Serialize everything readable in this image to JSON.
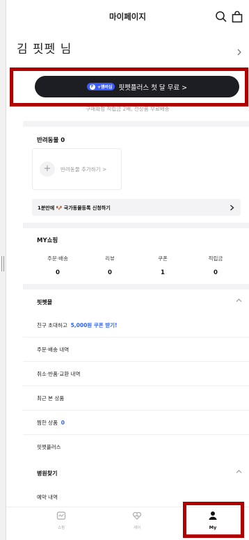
{
  "header": {
    "title": "마이페이지",
    "search_icon": "search-icon",
    "cart_icon": "shopping-bag-icon"
  },
  "user": {
    "name": "김 핏펫 님"
  },
  "membership": {
    "badge_letter": "F",
    "badge_text": "+멤버십",
    "cta_label": "핏펫플러스 첫 달 무료 >",
    "note": "구매확정 적립금 2배, 전상품 무료배송"
  },
  "pets": {
    "title": "반려동물 0",
    "add_label": "반려동물 추가하기 >",
    "register_label": "1분만에 🐶 국가동물등록 신청하기"
  },
  "my_shopping": {
    "title": "MY쇼핑",
    "stats": [
      {
        "label": "주문·배송",
        "value": "0"
      },
      {
        "label": "리뷰",
        "value": "0"
      },
      {
        "label": "쿠폰",
        "value": "1"
      },
      {
        "label": "적립금",
        "value": "0"
      }
    ]
  },
  "fitpet_mall": {
    "title": "핏펫몰",
    "invite_prefix": "친구 초대하고",
    "invite_highlight": "5,000원 쿠폰 받기!",
    "orders": "주문·배송 내역",
    "cancel": "취소·반품·교환 내역",
    "recent": "최근 본 상품",
    "liked": "찜한 상품",
    "liked_count": "0",
    "plus": "핏펫플러스"
  },
  "hospital": {
    "title": "병원찾기",
    "reservations": "예약 내역"
  },
  "tabs": [
    {
      "label": "쇼핑",
      "icon": "shopping-icon"
    },
    {
      "label": "케어",
      "icon": "heart-care-icon"
    },
    {
      "label": "My",
      "icon": "person-icon"
    }
  ]
}
